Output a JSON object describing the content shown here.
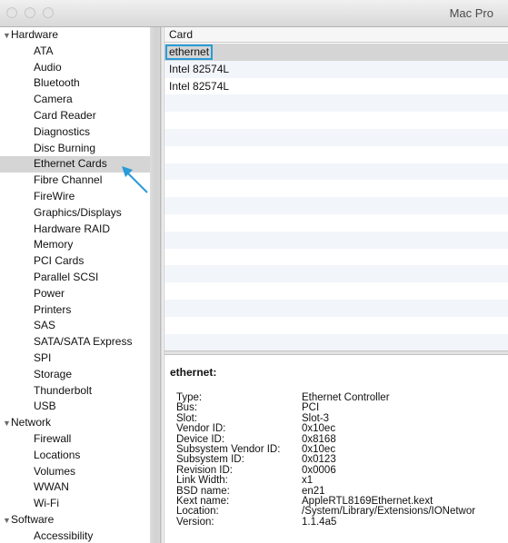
{
  "window": {
    "title": "Mac Pro"
  },
  "sidebar": {
    "items": [
      {
        "label": "Hardware",
        "kind": "group"
      },
      {
        "label": "ATA"
      },
      {
        "label": "Audio"
      },
      {
        "label": "Bluetooth"
      },
      {
        "label": "Camera"
      },
      {
        "label": "Card Reader"
      },
      {
        "label": "Diagnostics"
      },
      {
        "label": "Disc Burning"
      },
      {
        "label": "Ethernet Cards",
        "selected": true
      },
      {
        "label": "Fibre Channel"
      },
      {
        "label": "FireWire"
      },
      {
        "label": "Graphics/Displays"
      },
      {
        "label": "Hardware RAID"
      },
      {
        "label": "Memory"
      },
      {
        "label": "PCI Cards"
      },
      {
        "label": "Parallel SCSI"
      },
      {
        "label": "Power"
      },
      {
        "label": "Printers"
      },
      {
        "label": "SAS"
      },
      {
        "label": "SATA/SATA Express"
      },
      {
        "label": "SPI"
      },
      {
        "label": "Storage"
      },
      {
        "label": "Thunderbolt"
      },
      {
        "label": "USB"
      },
      {
        "label": "Network",
        "kind": "group"
      },
      {
        "label": "Firewall"
      },
      {
        "label": "Locations"
      },
      {
        "label": "Volumes"
      },
      {
        "label": "WWAN"
      },
      {
        "label": "Wi-Fi"
      },
      {
        "label": "Software",
        "kind": "group"
      },
      {
        "label": "Accessibility"
      }
    ]
  },
  "table": {
    "column_header": "Card",
    "rows": [
      "ethernet",
      "Intel 82574L",
      "Intel 82574L"
    ],
    "selected_index": 0
  },
  "details": {
    "title": "ethernet:",
    "properties": [
      {
        "key": "Type:",
        "value": "Ethernet Controller"
      },
      {
        "key": "Bus:",
        "value": "PCI"
      },
      {
        "key": "Slot:",
        "value": "Slot-3"
      },
      {
        "key": "Vendor ID:",
        "value": "0x10ec"
      },
      {
        "key": "Device ID:",
        "value": "0x8168"
      },
      {
        "key": "Subsystem Vendor ID:",
        "value": "0x10ec"
      },
      {
        "key": "Subsystem ID:",
        "value": "0x0123"
      },
      {
        "key": "Revision ID:",
        "value": "0x0006"
      },
      {
        "key": "Link Width:",
        "value": "x1"
      },
      {
        "key": "BSD name:",
        "value": "en21"
      },
      {
        "key": "Kext name:",
        "value": "AppleRTL8169Ethernet.kext"
      },
      {
        "key": "Location:",
        "value": "/System/Library/Extensions/IONetwor"
      },
      {
        "key": "Version:",
        "value": "1.1.4a5"
      }
    ]
  },
  "colors": {
    "selection_gray": "#d5d5d5",
    "highlight_blue": "#2a9bd8",
    "alt_row": "#f2f5fa"
  }
}
